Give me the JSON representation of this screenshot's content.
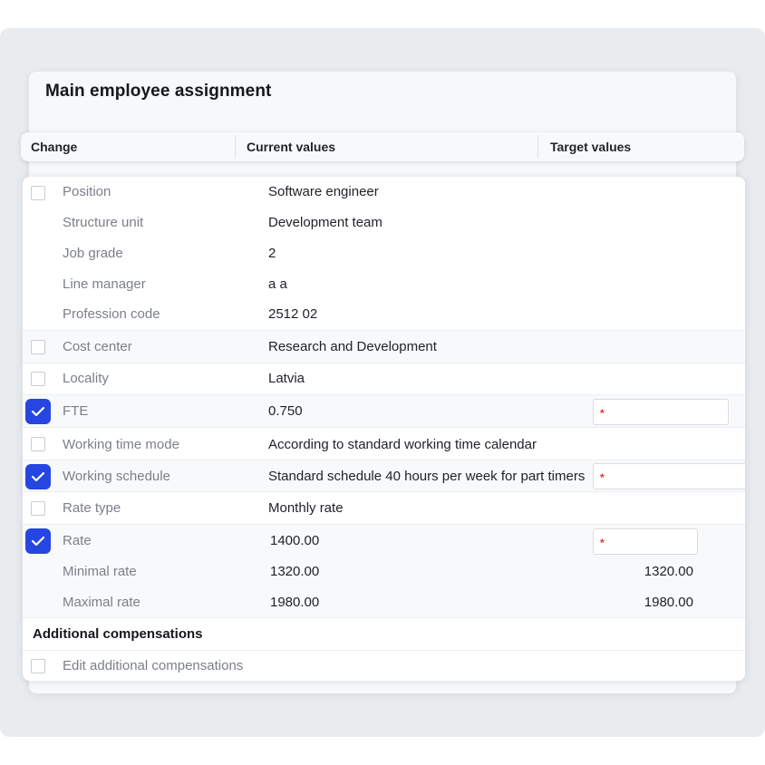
{
  "title": "Main employee assignment",
  "columns": {
    "change": "Change",
    "current": "Current values",
    "target": "Target values"
  },
  "rows": {
    "position": {
      "label": "Position",
      "value": "Software engineer"
    },
    "structure_unit": {
      "label": "Structure unit",
      "value": "Development team"
    },
    "job_grade": {
      "label": "Job grade",
      "value": "2"
    },
    "line_manager": {
      "label": "Line manager",
      "value": "a a"
    },
    "profession_code": {
      "label": "Profession code",
      "value": "2512 02"
    },
    "cost_center": {
      "label": "Cost center",
      "value": "Research and Development"
    },
    "locality": {
      "label": "Locality",
      "value": "Latvia"
    },
    "fte": {
      "label": "FTE",
      "value": "0.750",
      "checked": true,
      "required_mark": "*"
    },
    "working_time_mode": {
      "label": "Working time mode",
      "value": "According to standard working time calendar"
    },
    "working_schedule": {
      "label": "Working schedule",
      "value": "Standard schedule 40 hours per week for part timers",
      "checked": true,
      "required_mark": "*"
    },
    "rate_type": {
      "label": "Rate type",
      "value": "Monthly rate"
    },
    "rate": {
      "label": "Rate",
      "value": "1400.00",
      "checked": true,
      "required_mark": "*"
    },
    "minimal_rate": {
      "label": "Minimal rate",
      "value": "1320.00",
      "target": "1320.00"
    },
    "maximal_rate": {
      "label": "Maximal rate",
      "value": "1980.00",
      "target": "1980.00"
    }
  },
  "additional": {
    "title": "Additional compensations",
    "edit_label": "Edit additional compensations"
  },
  "colors": {
    "accent": "#2546e0",
    "required": "#d8382b"
  }
}
